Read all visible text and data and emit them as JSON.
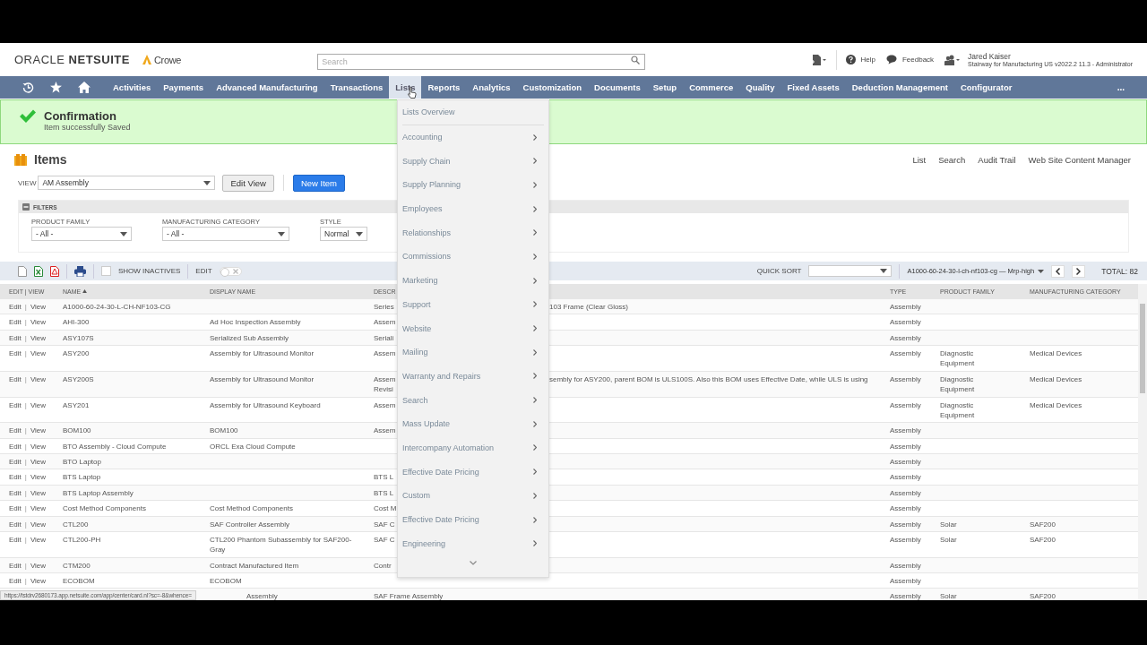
{
  "header": {
    "logo": "ORACLE **NETSUITE**",
    "partner": "Crowe",
    "search": {
      "placeholder": "Search"
    },
    "help": "Help",
    "feedback": "Feedback",
    "user": {
      "name": "Jared Kaiser",
      "role": "Stairway for Manufacturing US v2022.2 11.3 - Administrator"
    }
  },
  "nav": {
    "items": [
      {
        "label": "Activities",
        "selected": false
      },
      {
        "label": "Payments",
        "selected": false
      },
      {
        "label": "Advanced Manufacturing",
        "selected": false
      },
      {
        "label": "Transactions",
        "selected": false
      },
      {
        "label": "Lists",
        "selected": true
      },
      {
        "label": "Reports",
        "selected": false
      },
      {
        "label": "Analytics",
        "selected": false
      },
      {
        "label": "Customization",
        "selected": false
      },
      {
        "label": "Documents",
        "selected": false
      },
      {
        "label": "Setup",
        "selected": false
      },
      {
        "label": "Commerce",
        "selected": false
      },
      {
        "label": "Quality",
        "selected": false
      },
      {
        "label": "Fixed Assets",
        "selected": false
      },
      {
        "label": "Deduction Management",
        "selected": false
      },
      {
        "label": "Configurator",
        "selected": false
      }
    ],
    "more": "..."
  },
  "confirmation": {
    "title": "Confirmation",
    "message": "Item successfully Saved"
  },
  "page": {
    "title": "Items",
    "links": [
      "List",
      "Search",
      "Audit Trail",
      "Web Site Content Manager"
    ]
  },
  "view": {
    "label": "VIEW",
    "value": "AM Assembly",
    "edit_button": "Edit View",
    "new_button": "New Item"
  },
  "filters": {
    "title": "FILTERS",
    "expanded": true,
    "fields": [
      {
        "label": "PRODUCT FAMILY",
        "value": "- All -"
      },
      {
        "label": "MANUFACTURING CATEGORY",
        "value": "- All -"
      },
      {
        "label": "STYLE",
        "value": "Normal"
      }
    ]
  },
  "toolbar": {
    "show_inactives": {
      "label": "SHOW INACTIVES",
      "checked": false
    },
    "edit_toggle": {
      "label": "EDIT",
      "on": false
    },
    "quick_sort": "QUICK SORT",
    "page_select": "A1000-60-24-30-l-ch-nf103-cg — Mrp-high",
    "total": "TOTAL: 82"
  },
  "table": {
    "separator": "|",
    "columns": [
      {
        "label": "EDIT | VIEW",
        "sorted": false
      },
      {
        "label": "NAME",
        "sorted": true
      },
      {
        "label": "DISPLAY NAME",
        "sorted": false
      },
      {
        "label": "DESCR",
        "sorted": false
      },
      {
        "label": "TYPE",
        "sorted": false
      },
      {
        "label": "PRODUCT FAMILY",
        "sorted": false
      },
      {
        "label": "MANUFACTURING CATEGORY",
        "sorted": false
      }
    ],
    "rows": [
      {
        "edit": "Edit",
        "view": "View",
        "name": "A1000-60-24-30-L-CH-NF103-CG",
        "desc_left": "Series",
        "desc_right": "103 Frame (Clear Gloss)",
        "type": "Assembly"
      },
      {
        "edit": "Edit",
        "view": "View",
        "name": "AHI-300",
        "display": "Ad Hoc Inspection Assembly",
        "desc_left": "Assem",
        "type": "Assembly"
      },
      {
        "edit": "Edit",
        "view": "View",
        "name": "ASY107S",
        "display": "Serialized Sub Assembly",
        "desc_left": "Seriali",
        "type": "Assembly"
      },
      {
        "edit": "Edit",
        "view": "View",
        "name": "ASY200",
        "display": "Assembly for Ultrasound Monitor",
        "desc_left": "Assem",
        "type": "Assembly",
        "family": "Diagnostic Equipment",
        "category": "Medical Devices"
      },
      {
        "edit": "Edit",
        "view": "View",
        "name": "ASY200S",
        "display": "Assembly for Ultrasound Monitor",
        "desc_left": "Assem\nRevisi",
        "desc_right": "sembly for ASY200, parent BOM is ULS100S. Also this BOM uses Effective Date, while ULS is using",
        "type": "Assembly",
        "family": "Diagnostic Equipment",
        "category": "Medical Devices"
      },
      {
        "edit": "Edit",
        "view": "View",
        "name": "ASY201",
        "display": "Assembly for Ultrasound Keyboard",
        "desc_left": "Assem",
        "type": "Assembly",
        "family": "Diagnostic Equipment",
        "category": "Medical Devices"
      },
      {
        "edit": "Edit",
        "view": "View",
        "name": "BOM100",
        "display": "BOM100",
        "desc_left": "Assem",
        "type": "Assembly"
      },
      {
        "edit": "Edit",
        "view": "View",
        "name": "BTO Assembly - Cloud Compute",
        "display": "ORCL Exa Cloud Compute",
        "type": "Assembly"
      },
      {
        "edit": "Edit",
        "view": "View",
        "name": "BTO Laptop",
        "type": "Assembly"
      },
      {
        "edit": "Edit",
        "view": "View",
        "name": "BTS Laptop",
        "desc_left": "BTS L",
        "type": "Assembly"
      },
      {
        "edit": "Edit",
        "view": "View",
        "name": "BTS Laptop Assembly",
        "desc_left": "BTS L",
        "type": "Assembly"
      },
      {
        "edit": "Edit",
        "view": "View",
        "name": "Cost Method Components",
        "display": "Cost Method Components",
        "desc_left": "Cost M",
        "type": "Assembly"
      },
      {
        "edit": "Edit",
        "view": "View",
        "name": "CTL200",
        "display": "SAF Controller Assembly",
        "desc_left": "SAF C",
        "type": "Assembly",
        "family": "Solar",
        "category": "SAF200"
      },
      {
        "edit": "Edit",
        "view": "View",
        "name": "CTL200-PH",
        "display": "CTL200 Phantom Subassembly for SAF200-Gray",
        "desc_left": "SAF C",
        "type": "Assembly",
        "family": "Solar",
        "category": "SAF200"
      },
      {
        "edit": "Edit",
        "view": "View",
        "name": "CTM200",
        "display": "Contract Manufactured Item",
        "desc_left": "Contr",
        "type": "Assembly"
      },
      {
        "edit": "Edit",
        "view": "View",
        "name": "ECOBOM",
        "display": "ECOBOM",
        "type": "Assembly"
      },
      {
        "display": "Assembly",
        "desc_left": "SAF Frame Assembly",
        "type": "Assembly",
        "family": "Solar",
        "category": "SAF200"
      }
    ]
  },
  "lists_menu": {
    "items": [
      {
        "label": "Lists Overview",
        "submenu": false
      },
      {
        "label": "Accounting",
        "submenu": true
      },
      {
        "label": "Supply Chain",
        "submenu": true
      },
      {
        "label": "Supply Planning",
        "submenu": true
      },
      {
        "label": "Employees",
        "submenu": true
      },
      {
        "label": "Relationships",
        "submenu": true
      },
      {
        "label": "Commissions",
        "submenu": true
      },
      {
        "label": "Marketing",
        "submenu": true
      },
      {
        "label": "Support",
        "submenu": true
      },
      {
        "label": "Website",
        "submenu": true
      },
      {
        "label": "Mailing",
        "submenu": true
      },
      {
        "label": "Warranty and Repairs",
        "submenu": true
      },
      {
        "label": "Search",
        "submenu": true
      },
      {
        "label": "Mass Update",
        "submenu": true
      },
      {
        "label": "Intercompany Automation",
        "submenu": true
      },
      {
        "label": "Effective Date Pricing",
        "submenu": true
      },
      {
        "label": "Custom",
        "submenu": true
      },
      {
        "label": "Effective Date Pricing",
        "submenu": true
      },
      {
        "label": "Engineering",
        "submenu": true
      }
    ]
  },
  "status_url": "https://tstdrv2680173.app.netsuite.com/app/center/card.nl?sc=-8&whence="
}
